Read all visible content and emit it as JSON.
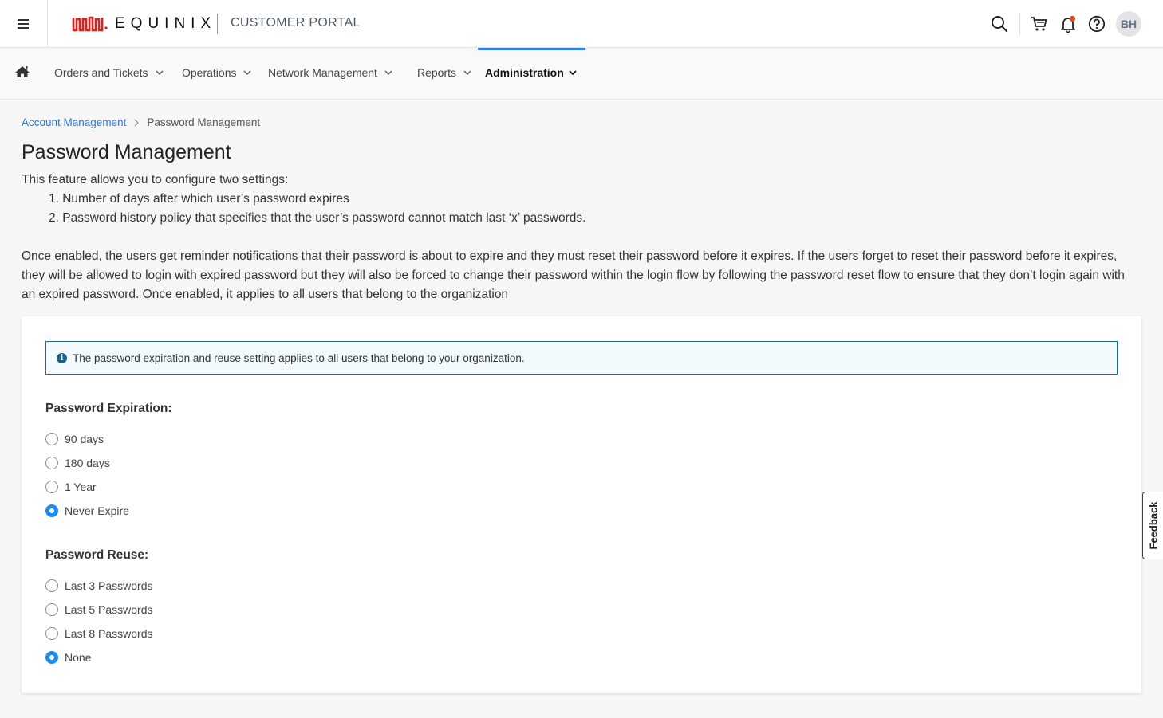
{
  "header": {
    "brand": "EQUINIX",
    "portal": "CUSTOMER PORTAL",
    "avatar_initials": "BH",
    "icons": [
      "menu-icon",
      "search-icon",
      "cart-icon",
      "bell-icon",
      "help-icon"
    ],
    "notification_dot_color": "#e24a1e"
  },
  "nav": {
    "items": [
      {
        "label": "Orders and Tickets"
      },
      {
        "label": "Operations"
      },
      {
        "label": "Network Management"
      },
      {
        "label": "Reports"
      },
      {
        "label": "Administration"
      }
    ],
    "active": "Administration",
    "accent_color": "#2b7de9"
  },
  "breadcrumb": {
    "parent": "Account Management",
    "current": "Password Management"
  },
  "page": {
    "title": "Password Management",
    "intro": "This feature allows you to configure two settings:",
    "list": [
      "1. Number of days after which user’s password expires",
      "2. Password history policy that specifies that the user’s password cannot match last ‘x’ passwords."
    ],
    "description": "Once enabled, the users get reminder notifications that their password is about to expire and they must reset their password before it expires. If the users forget to reset their password before it expires, they will be allowed to login with expired password but they will also be forced to change their password within the login flow by following the password reset flow to ensure that they don’t login again with an expired password. Once enabled, it applies to all users that belong to the organization"
  },
  "alert": {
    "icon": "info-icon",
    "text": "The password expiration and reuse setting applies to all users that belong to your organization."
  },
  "expiration": {
    "title": "Password Expiration:",
    "options": [
      "90 days",
      "180 days",
      "1 Year",
      "Never Expire"
    ],
    "selected": "Never Expire"
  },
  "reuse": {
    "title": "Password Reuse:",
    "options": [
      "Last 3 Passwords",
      "Last 5 Passwords",
      "Last 8 Passwords",
      "None"
    ],
    "selected": "None"
  },
  "feedback": {
    "label": "Feedback"
  }
}
